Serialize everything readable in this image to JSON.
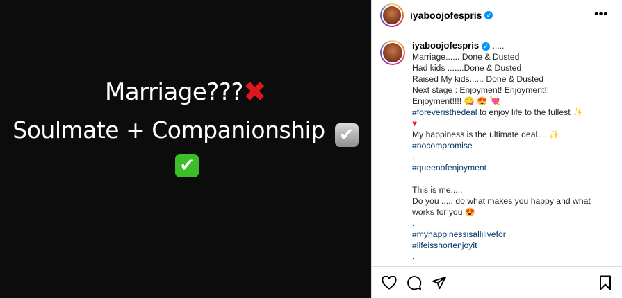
{
  "media": {
    "line1_text": "Marriage???",
    "line1_emoji": "✖",
    "line2_text": "Soulmate + Companionship",
    "check_grey": "✔",
    "check_green": "✔"
  },
  "header": {
    "username": "iyaboojofespris",
    "verified_mark": "✓",
    "more": "•••"
  },
  "caption": {
    "username": "iyaboojofespris",
    "verified_mark": "✓",
    "intro": " .....",
    "lines": [
      "Marriage...... Done & Dusted",
      "Had kids .......Done & Dusted",
      "Raised My kids...... Done & Dusted",
      "Next stage : Enjoyment! Enjoyment!!",
      "Enjoyment!!!! 😋 😍 💘"
    ],
    "tag1": "#foreveristhedeal",
    "tag1_after": " to enjoy life to the fullest ✨",
    "heart": "♥",
    "happiness": "My happiness is the ultimate deal.... ✨",
    "tag2": "#nocompromise",
    "dot1": ".",
    "tag3": "#queenofenjoyment",
    "this_is_me": "This is me.....",
    "do_you": "Do you ..... do what makes you happy and what works for you 😍",
    "dot2": ".",
    "tag4": "#myhappinessisallilivefor",
    "tag5": "#lifeisshortenjoyit",
    "dot3": "."
  },
  "actions": {
    "like": "heart-icon",
    "comment": "comment-icon",
    "share": "share-icon",
    "save": "bookmark-icon"
  },
  "colors": {
    "media_bg": "#0c0c0c",
    "hashtag": "#00376b",
    "verified": "#0095f6"
  }
}
